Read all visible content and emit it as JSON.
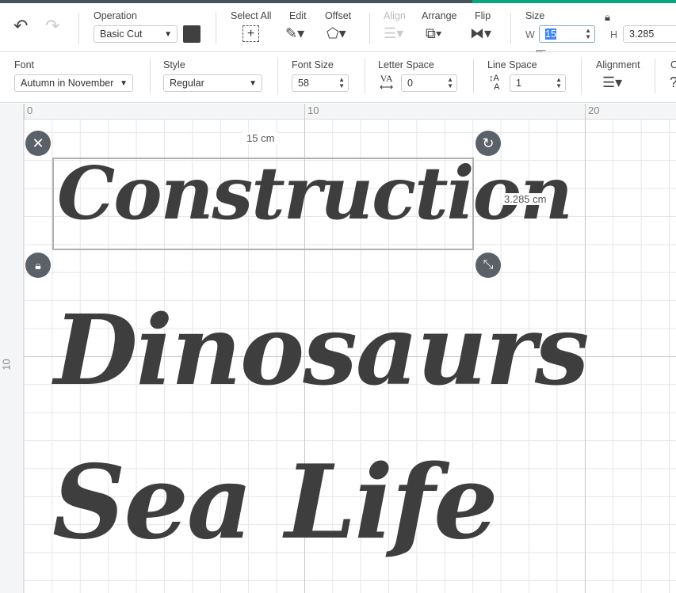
{
  "toolbar": {
    "undo_icon": "undo-icon",
    "redo_icon": "redo-icon",
    "operation": {
      "label": "Operation",
      "value": "Basic Cut",
      "color": "#404040"
    },
    "select_all": "Select All",
    "edit": "Edit",
    "offset": "Offset",
    "align": "Align",
    "arrange": "Arrange",
    "flip": "Flip",
    "size": {
      "label": "Size",
      "w_label": "W",
      "w_value": "15",
      "h_label": "H",
      "h_value": "3.285"
    }
  },
  "text_toolbar": {
    "font": {
      "label": "Font",
      "value": "Autumn in November"
    },
    "style": {
      "label": "Style",
      "value": "Regular"
    },
    "font_size": {
      "label": "Font Size",
      "value": "58"
    },
    "letter_space": {
      "label": "Letter Space",
      "value": "0",
      "icon_text": "VA"
    },
    "line_space": {
      "label": "Line Space",
      "value": "1"
    },
    "alignment": {
      "label": "Alignment"
    },
    "cut_off_label": "C"
  },
  "ruler": {
    "top": [
      "0",
      "10",
      "20"
    ],
    "left": [
      "10"
    ]
  },
  "canvas": {
    "texts": [
      "Construction",
      "Dinosaurs",
      "Sea Life"
    ],
    "width_label": "15 cm",
    "height_label": "3.285 cm"
  }
}
